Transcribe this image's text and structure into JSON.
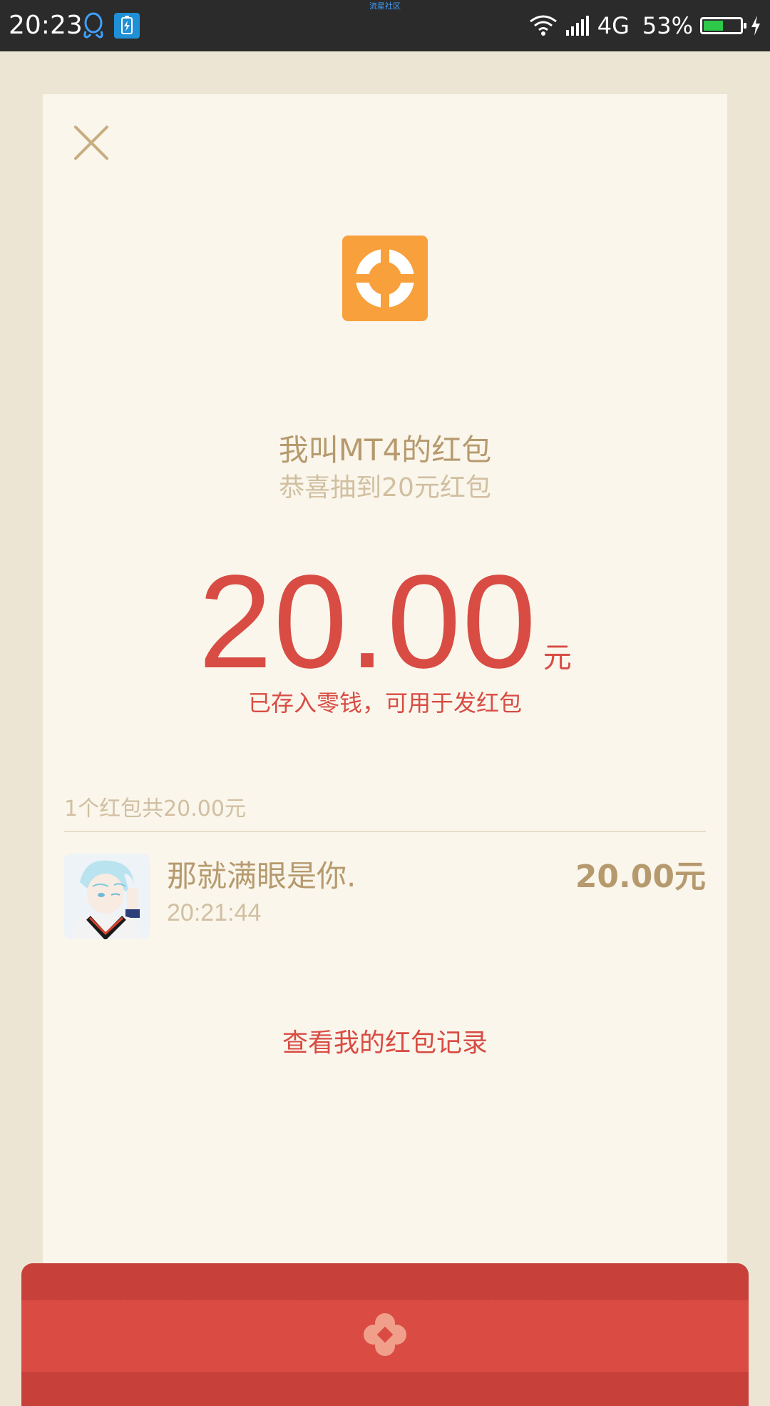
{
  "status_bar": {
    "time": "20:23",
    "center_label": "流星社区",
    "network": "4G",
    "battery_percent_text": "53%",
    "battery_level": 0.53,
    "icons": [
      "qq-icon",
      "battery-saver-app-icon",
      "wifi-icon",
      "signal-icon",
      "battery-icon",
      "charging-icon"
    ]
  },
  "card": {
    "close_icon": "close-icon",
    "logo_icon": "red-packet-logo-icon",
    "title": "我叫MT4的红包",
    "subtitle": "恭喜抽到20元红包",
    "amount": "20.00",
    "amount_unit": "元",
    "stored_text": "已存入零钱，可用于发红包",
    "summary": "1个红包共20.00元",
    "record": {
      "name": "那就满眼是你.",
      "time": "20:21:44",
      "amount": "20.00元"
    },
    "view_records_link": "查看我的红包记录"
  },
  "colors": {
    "accent_red": "#d84c43",
    "gold_text": "#b69a6e",
    "muted_text": "#d1bfa0",
    "logo_orange": "#f8a03c",
    "card_bg": "#faf6ec",
    "page_bg": "#ede5d4"
  }
}
